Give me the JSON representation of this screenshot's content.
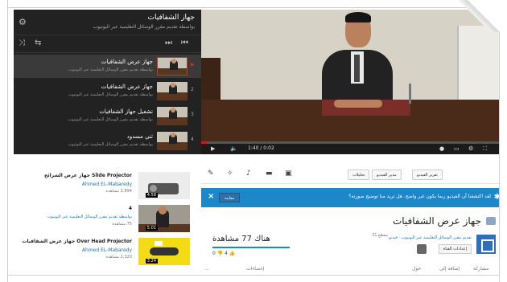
{
  "playlist": {
    "title": "جهاز الشفافيات",
    "subtitle": "بواسطة تقديم مقرر الوسائل التعليمية عبر اليوتيوب",
    "items": [
      {
        "num": "▶",
        "name": "جهاز عرض الشفافيات",
        "by": "بواسطة تقديم مقرر الوسائل التعليمية عبر اليوتيوب"
      },
      {
        "num": "2",
        "name": "جهاز عرض الشفافيات",
        "by": "بواسطة تقديم مقرر الوسائل التعليمية عبر اليوتيوب"
      },
      {
        "num": "3",
        "name": "تشغيل جهاز الشفافيات",
        "by": "بواسطة تقديم مقرر الوسائل التعليمية عبر اليوتيوب"
      },
      {
        "num": "4",
        "name": "ثني مسدود",
        "by": "بواسطة تقديم مقرر الوسائل التعليمية عبر اليوتيوب"
      }
    ]
  },
  "player": {
    "time": "1:40 / 0:02",
    "progress": 0.02
  },
  "actions": {
    "btn1": "تحليلات",
    "btn2": "مدير الفيديو",
    "btn3": "تقرير الفيديو"
  },
  "notice": {
    "text": "لقد اكتشفنا أن الفيديو ربما يكون غير واضح. هل تريد منا توضيح صورته؟",
    "button": "معاينة",
    "close": "×"
  },
  "info": {
    "title": "جهاز عرض الشفافيات",
    "channel": "تقديم مقرر الوسائل التعليمية عبر اليوتيوب · فيديو",
    "channel_count": "31 مقطع",
    "subscribe": "إعدادات القناة",
    "views": "هناك 77 مشاهدة",
    "views_progress": 1,
    "likes": "0 👎   4 👍",
    "tabs": [
      "مشاركة",
      "إضافة إلى",
      "حول",
      "",
      "",
      "",
      "إحصاءات",
      "..."
    ]
  },
  "related": {
    "header": "جهاز عرض الشرائح Slide Projector",
    "items": [
      {
        "title": "Slide Projector جهاز عرض الشرائح",
        "channel": "Ahmed EL-Mabaredy",
        "views": "2,894 مشاهدة",
        "duration": "4:58"
      },
      {
        "title": "4",
        "channel": "بواسطة تقديم مقرر الوسائل التعليمية عبر اليوتيوب",
        "views": "75 مشاهدة",
        "duration": "5:01"
      },
      {
        "title": "Over Head Projector جهاز عرض الشفافيات",
        "channel": "Ahmed EL-Mabaredy",
        "views": "2,320 مشاهدة",
        "duration": "3:24"
      }
    ]
  }
}
